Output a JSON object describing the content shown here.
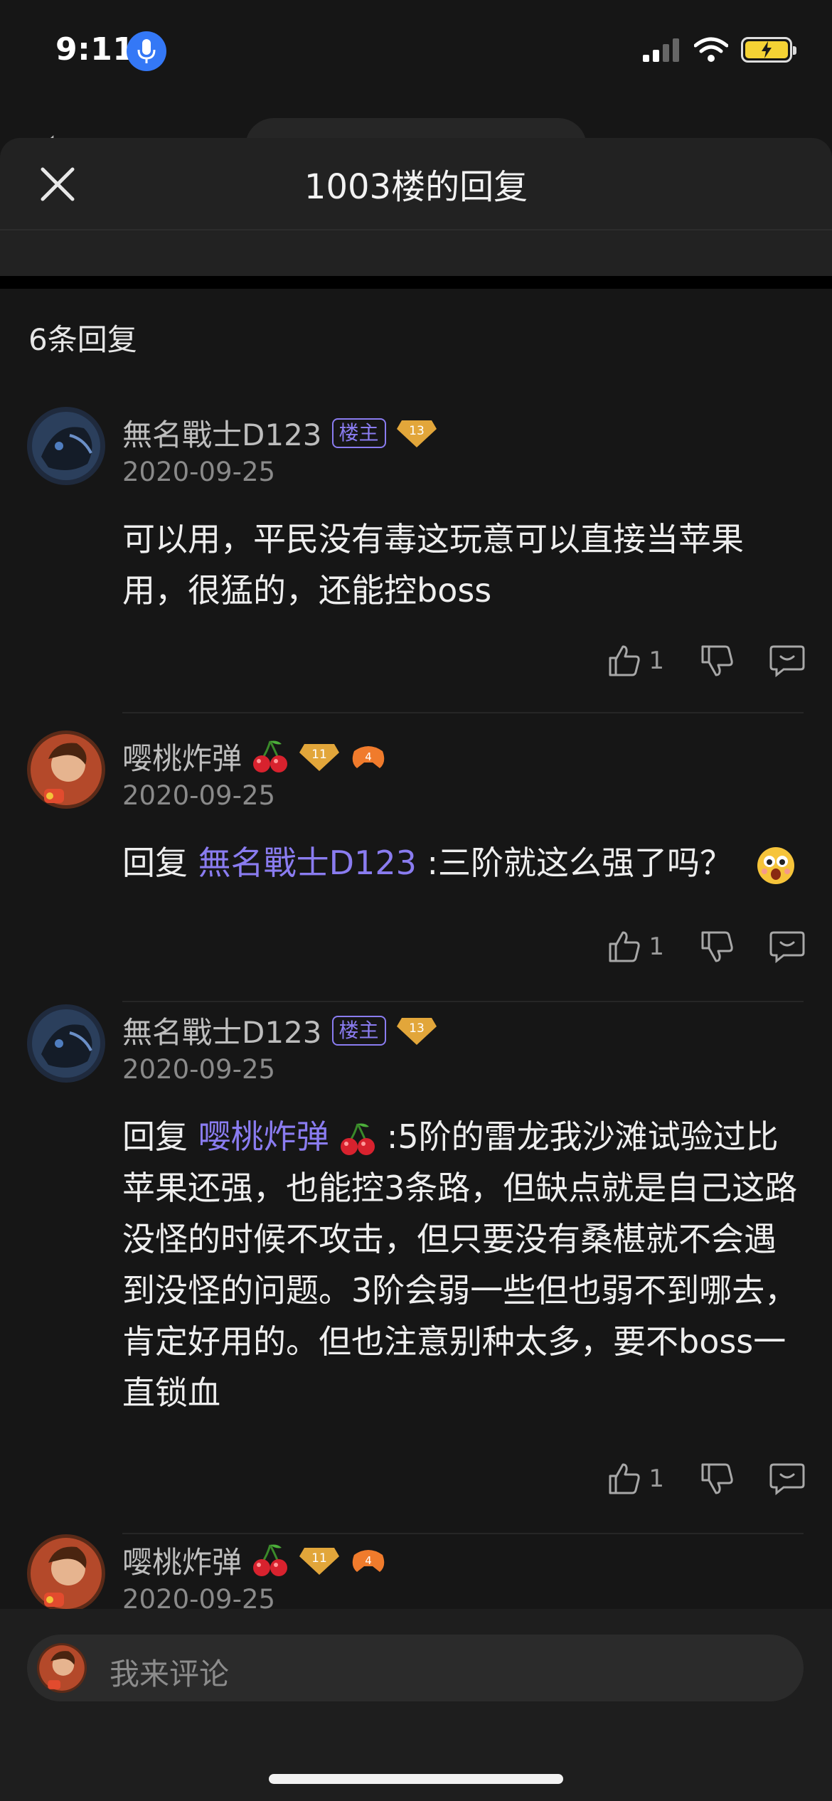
{
  "status": {
    "time": "9:11"
  },
  "sheet": {
    "title": "1003楼的回复",
    "reply_count": "6条回复"
  },
  "comments": [
    {
      "author": "無名戰士D123",
      "owner_badge": "楼主",
      "level": "13",
      "date": "2020-09-25",
      "text": "可以用，平民没有毒这玩意可以直接当苹果用，很猛的，还能控boss",
      "likes": "1"
    },
    {
      "author": "嘤桃炸弹",
      "level": "11",
      "extra_level": "4",
      "date": "2020-09-25",
      "reply_prefix": "回复",
      "mention": "無名戰士D123",
      "text": ":三阶就这么强了吗？",
      "likes": "1"
    },
    {
      "author": "無名戰士D123",
      "owner_badge": "楼主",
      "level": "13",
      "date": "2020-09-25",
      "reply_prefix": "回复",
      "mention": "嘤桃炸弹",
      "text": " :5阶的雷龙我沙滩试验过比苹果还强，也能控3条路，但缺点就是自己这路没怪的时候不攻击，但只要没有桑椹就不会遇到没怪的问题。3阶会弱一些但也弱不到哪去，肯定好用的。但也注意别种太多，要不boss一直锁血",
      "likes": "1"
    },
    {
      "author": "嘤桃炸弹",
      "level": "11",
      "extra_level": "4",
      "date": "2020-09-25"
    }
  ],
  "composer": {
    "placeholder": "我来评论"
  },
  "colors": {
    "accent": "#8a7cf0",
    "background": "#161616",
    "level_badge": "#e2a63a"
  }
}
